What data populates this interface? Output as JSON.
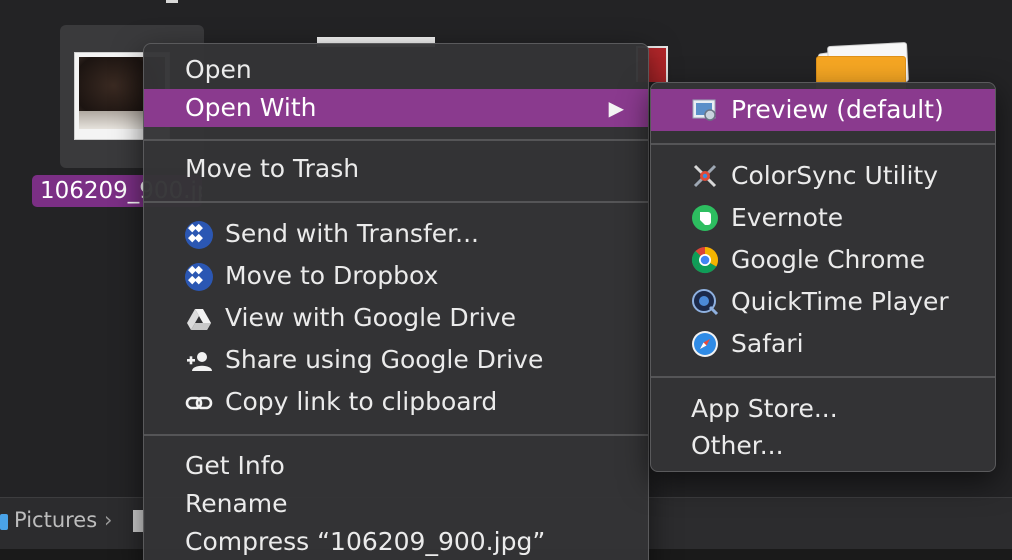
{
  "finder": {
    "file_label": "106209_900.jpg",
    "path_folder": "Pictures",
    "path_chevron": "›"
  },
  "context_menu": {
    "open": "Open",
    "open_with": "Open With",
    "open_with_arrow": "▶",
    "move_to_trash": "Move to Trash",
    "send_with_transfer": "Send with Transfer...",
    "move_to_dropbox": "Move to Dropbox",
    "view_google_drive": "View with Google Drive",
    "share_google_drive": "Share using Google Drive",
    "copy_link": "Copy link to clipboard",
    "get_info": "Get Info",
    "rename": "Rename",
    "compress": "Compress “106209_900.jpg”"
  },
  "open_with_submenu": {
    "preview": "Preview (default)",
    "colorsync": "ColorSync Utility",
    "evernote": "Evernote",
    "chrome": "Google Chrome",
    "quicktime": "QuickTime Player",
    "safari": "Safari",
    "app_store": "App Store...",
    "other": "Other..."
  },
  "colors": {
    "highlight": "#8a3a8e",
    "menu_bg": "#343436",
    "selected_label_bg": "#7b2f85"
  }
}
